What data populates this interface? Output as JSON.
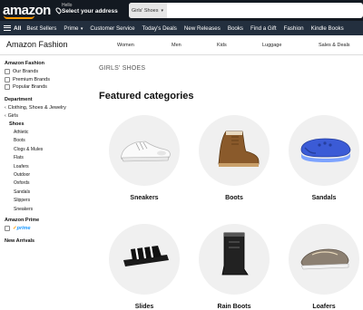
{
  "header": {
    "logo": "amazon",
    "deliver_line1": "Hello",
    "deliver_line2": "Select your address",
    "search_category": "Girls' Shoes"
  },
  "nav": {
    "all": "All",
    "items": [
      "Best Sellers",
      "Prime",
      "Customer Service",
      "Today's Deals",
      "New Releases",
      "Books",
      "Find a Gift",
      "Fashion",
      "Kindle Books"
    ]
  },
  "subnav": {
    "title": "Amazon Fashion",
    "links": [
      "Women",
      "Men",
      "Kids",
      "Luggage",
      "Sales & Deals"
    ]
  },
  "sidebar": {
    "section1_title": "Amazon Fashion",
    "checkboxes": [
      "Our Brands",
      "Premium Brands",
      "Popular Brands"
    ],
    "department_title": "Department",
    "back_links": [
      "Clothing, Shoes & Jewelry",
      "Girls"
    ],
    "current": "Shoes",
    "items": [
      "Athletic",
      "Boots",
      "Clogs & Mules",
      "Flats",
      "Loafers",
      "Outdoor",
      "Oxfords",
      "Sandals",
      "Slippers",
      "Sneakers"
    ],
    "prime_title": "Amazon Prime",
    "prime_label": "prime",
    "new_arrivals_title": "New Arrivals"
  },
  "main": {
    "breadcrumb": "GIRLS' SHOES",
    "heading": "Featured categories",
    "categories": [
      "Sneakers",
      "Boots",
      "Sandals",
      "Slides",
      "Rain Boots",
      "Loafers"
    ]
  },
  "colors": {
    "topbar": "#131921",
    "navbar": "#232f3e",
    "accent": "#ff9900",
    "prime_blue": "#1a98ff"
  }
}
